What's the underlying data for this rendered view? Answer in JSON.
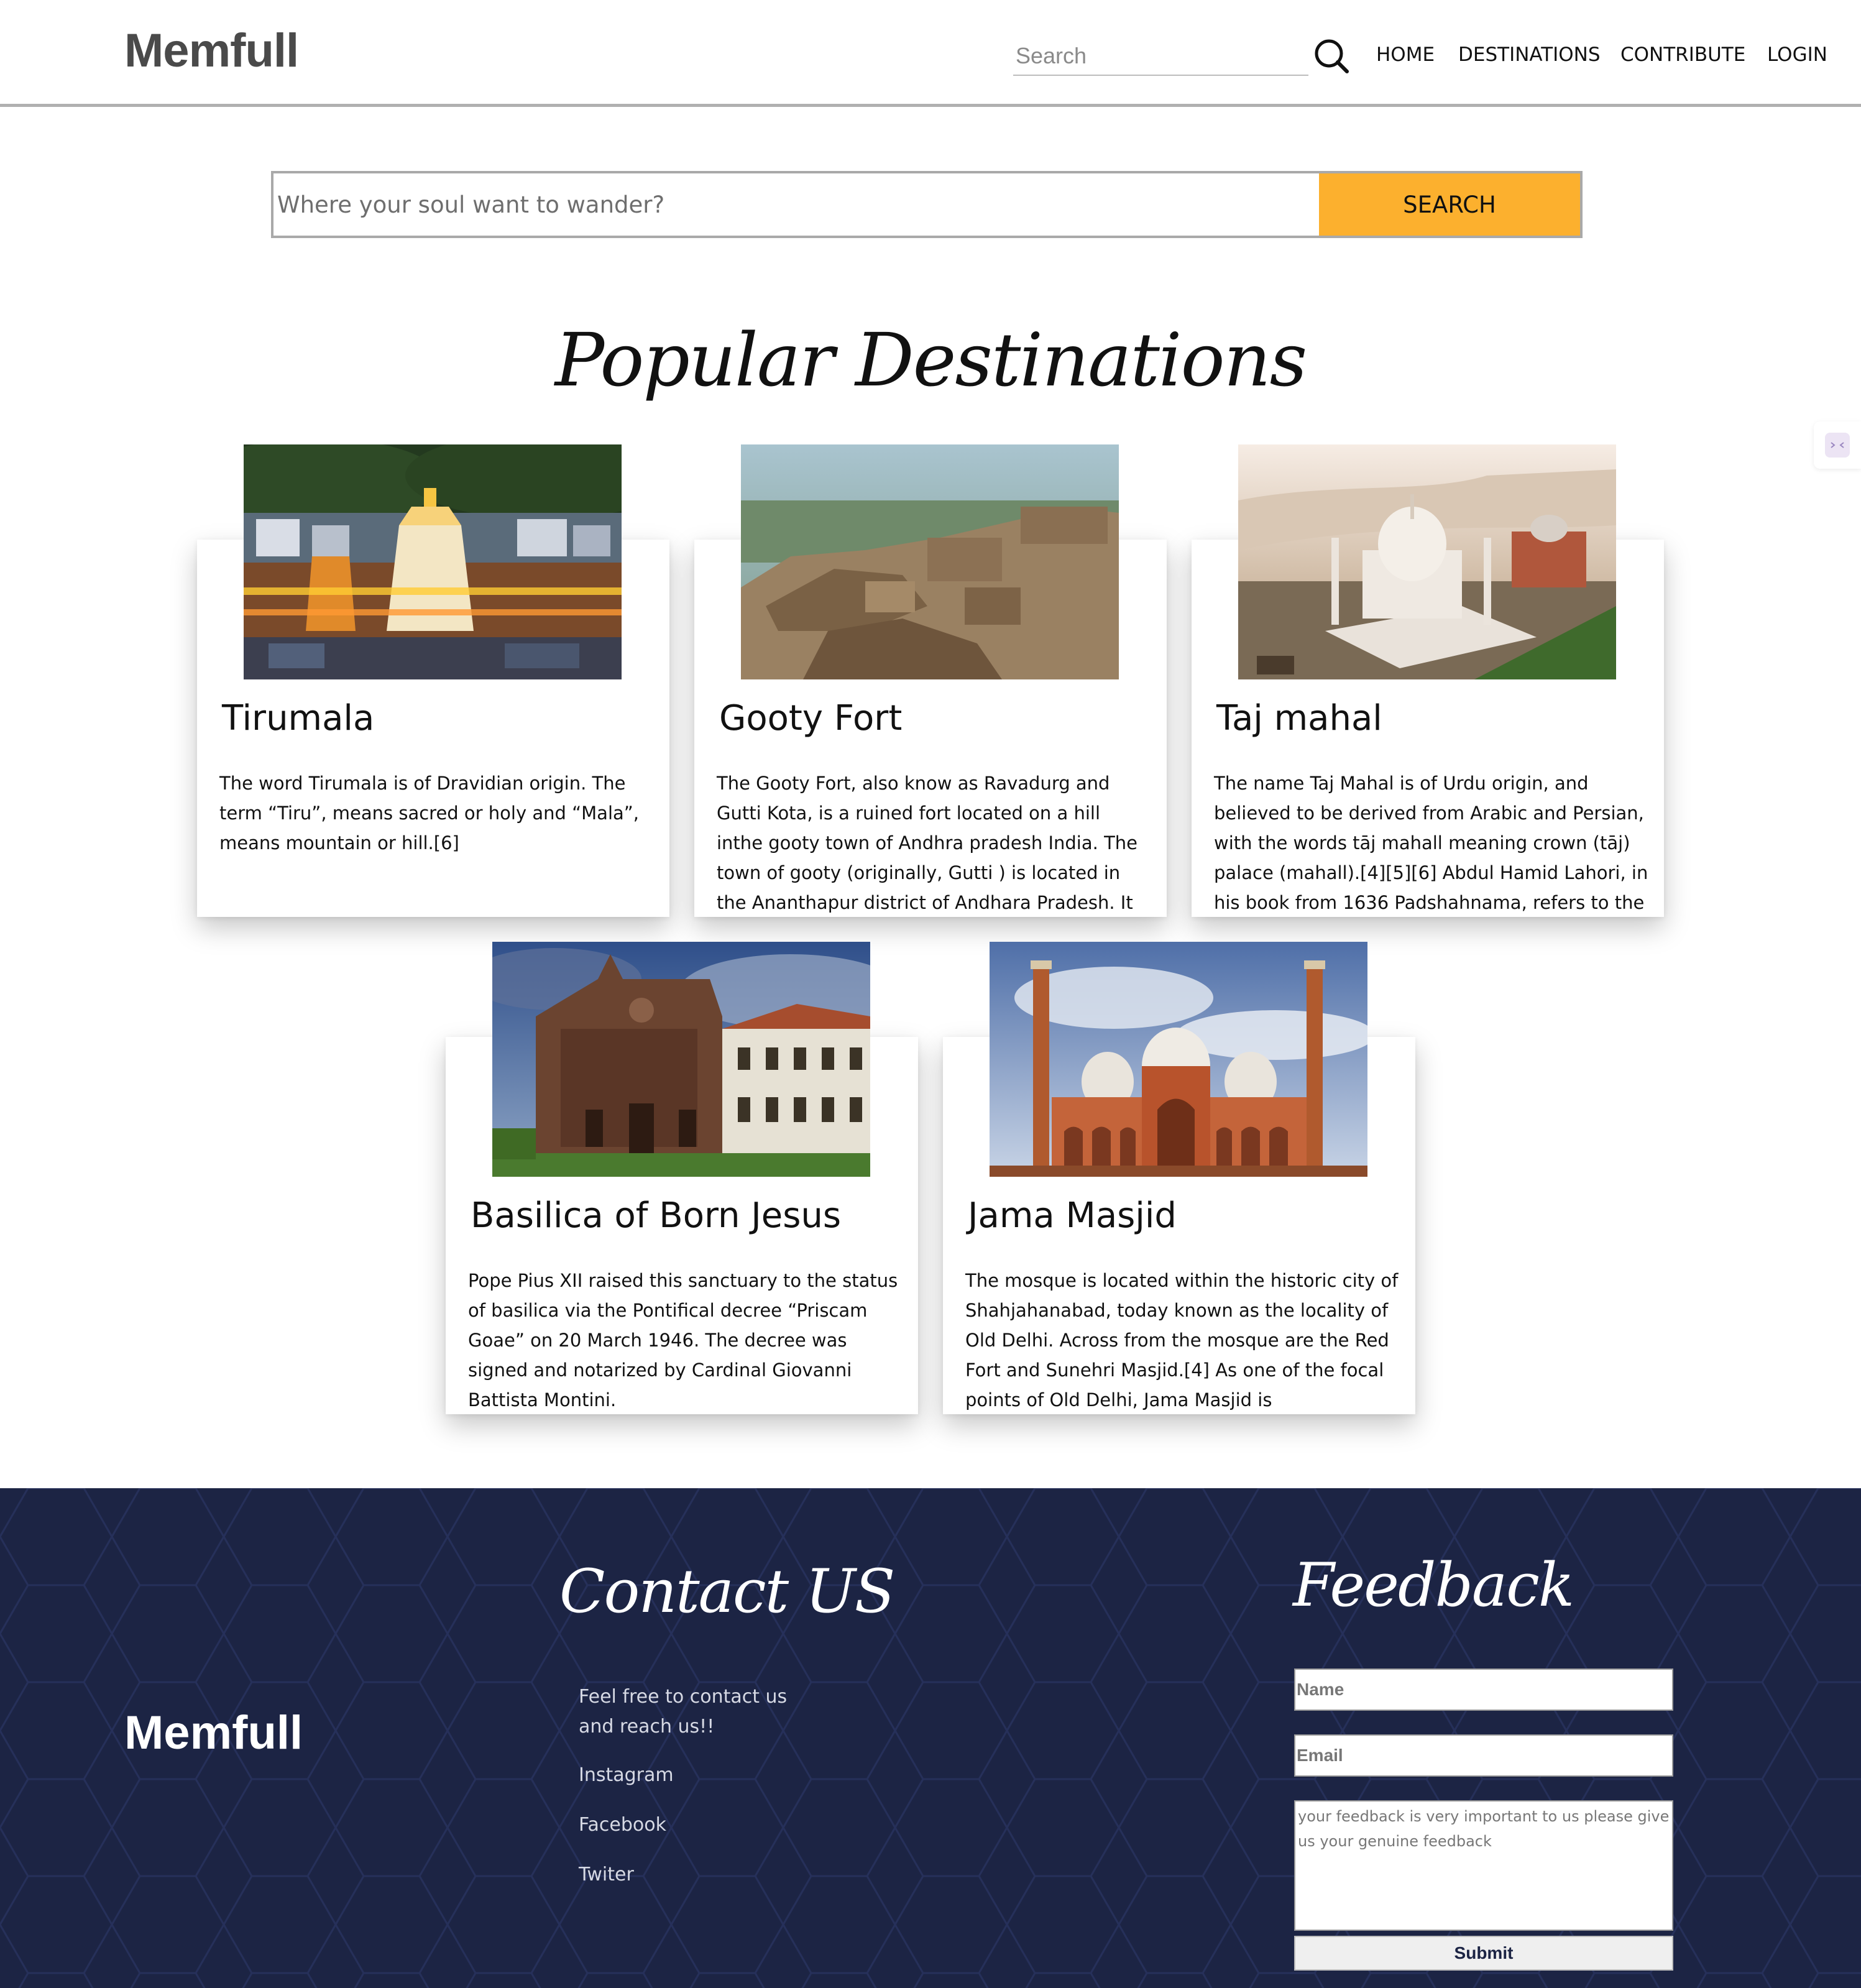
{
  "header": {
    "logo": "Memfull",
    "search_placeholder": "Search",
    "nav": [
      "HOME",
      "DESTINATIONS",
      "CONTRIBUTE",
      "LOGIN"
    ]
  },
  "hero": {
    "placeholder": "Where your soul want to wander?",
    "button": "SEARCH"
  },
  "section_title": "Popular Destinations",
  "cards": [
    {
      "title": "Tirumala",
      "text": "The word Tirumala is of Dravidian origin. The term “Tiru”, means sacred or holy and “Mala”, means mountain or hill.[6]"
    },
    {
      "title": "Gooty Fort",
      "text": "The Gooty Fort, also know as Ravadurg and Gutti Kota, is a ruined fort located on a hill inthe gooty town of Andhra pradesh India. The town of gooty (originally, Gutti ) is located in the Ananthapur district of Andhara Pradesh. It is"
    },
    {
      "title": "Taj mahal",
      "text": "The name Taj Mahal is of Urdu origin, and believed to be derived from Arabic and Persian, with the words tāj mahall meaning crown (tāj) palace (mahall).[4][5][6] Abdul Hamid Lahori, in his book from 1636 Padshahnama, refers to the"
    },
    {
      "title": "Basilica of Born Jesus",
      "text": "Pope Pius XII raised this sanctuary to the status of basilica via the Pontifical decree “Priscam Goae” on 20 March 1946. The decree was signed and notarized by Cardinal Giovanni Battista Montini."
    },
    {
      "title": "Jama Masjid",
      "text": "The mosque is located within the historic city of Shahjahanabad, today known as the locality of Old Delhi. Across from the mosque are the Red Fort and Sunehri Masjid.[4] As one of the focal points of Old Delhi, Jama Masjid is"
    }
  ],
  "footer": {
    "logo": "Memfull",
    "contact_heading": "Contact US",
    "contact_text": "Feel free to contact us and reach us!!",
    "links": [
      "Instagram",
      "Facebook",
      "Twiter"
    ],
    "feedback_heading": "Feedback",
    "name_placeholder": "Name",
    "email_placeholder": "Email",
    "feedback_placeholder": "your feedback is very important to us please give us your genuine feedback",
    "submit": "Submit"
  },
  "colors": {
    "accent": "#fcb02e",
    "footer_bg": "#1c2444",
    "logo_gray": "#4a4a4a"
  }
}
